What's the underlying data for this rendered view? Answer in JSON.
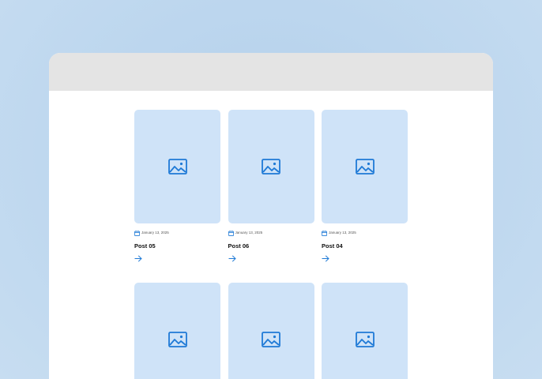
{
  "colors": {
    "background": "#bcd6ee",
    "titlebar": "#e4e4e4",
    "thumb": "#cfe3f8",
    "accent": "#1f7ad6"
  },
  "icons": {
    "thumbnail": "image-placeholder-icon",
    "date": "calendar-icon",
    "link": "arrow-right-icon"
  },
  "posts": [
    {
      "date": "January 13, 2025",
      "title": "Post 05"
    },
    {
      "date": "January 13, 2025",
      "title": "Post 06"
    },
    {
      "date": "January 13, 2025",
      "title": "Post 04"
    }
  ]
}
